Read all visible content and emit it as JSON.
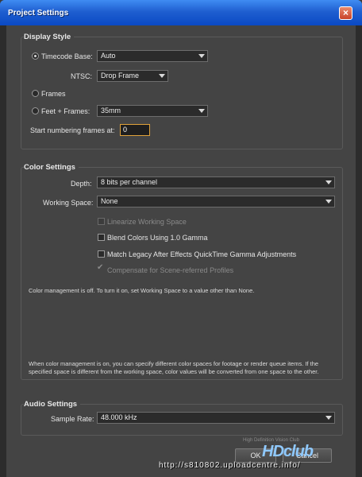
{
  "window": {
    "title": "Project Settings",
    "close_glyph": "×"
  },
  "display_style": {
    "title": "Display Style",
    "timecode_base_label": "Timecode Base:",
    "timecode_base_value": "Auto",
    "ntsc_label": "NTSC:",
    "ntsc_value": "Drop Frame",
    "frames_label": "Frames",
    "feet_frames_label": "Feet + Frames:",
    "feet_frames_value": "35mm",
    "start_numbering_label": "Start numbering frames at:",
    "start_numbering_value": "0",
    "selected": "timecode"
  },
  "color_settings": {
    "title": "Color Settings",
    "depth_label": "Depth:",
    "depth_value": "8 bits per channel",
    "working_space_label": "Working Space:",
    "working_space_value": "None",
    "linearize_label": "Linearize Working Space",
    "blend_label": "Blend Colors Using 1.0 Gamma",
    "match_legacy_label": "Match Legacy After Effects QuickTime Gamma Adjustments",
    "compensate_label": "Compensate for Scene-referred Profiles",
    "note_off": "Color management is off. To turn it on, set Working Space to a value other than None.",
    "note_on": "When color management is on, you can specify different color spaces for footage or render queue items. If the specified space is different from the working space, color values will be converted from one space to the other."
  },
  "audio_settings": {
    "title": "Audio Settings",
    "sample_rate_label": "Sample Rate:",
    "sample_rate_value": "48.000 kHz"
  },
  "buttons": {
    "ok": "OK",
    "cancel": "Cancel"
  },
  "watermark": {
    "url": "http://s810802.uploadcentre.info/",
    "logo": "HDclub",
    "tagline": "High Definition Vision Club"
  },
  "colors": {
    "titlebar": "#0a49c4",
    "panel": "#444444",
    "focus": "#e0a23a"
  }
}
